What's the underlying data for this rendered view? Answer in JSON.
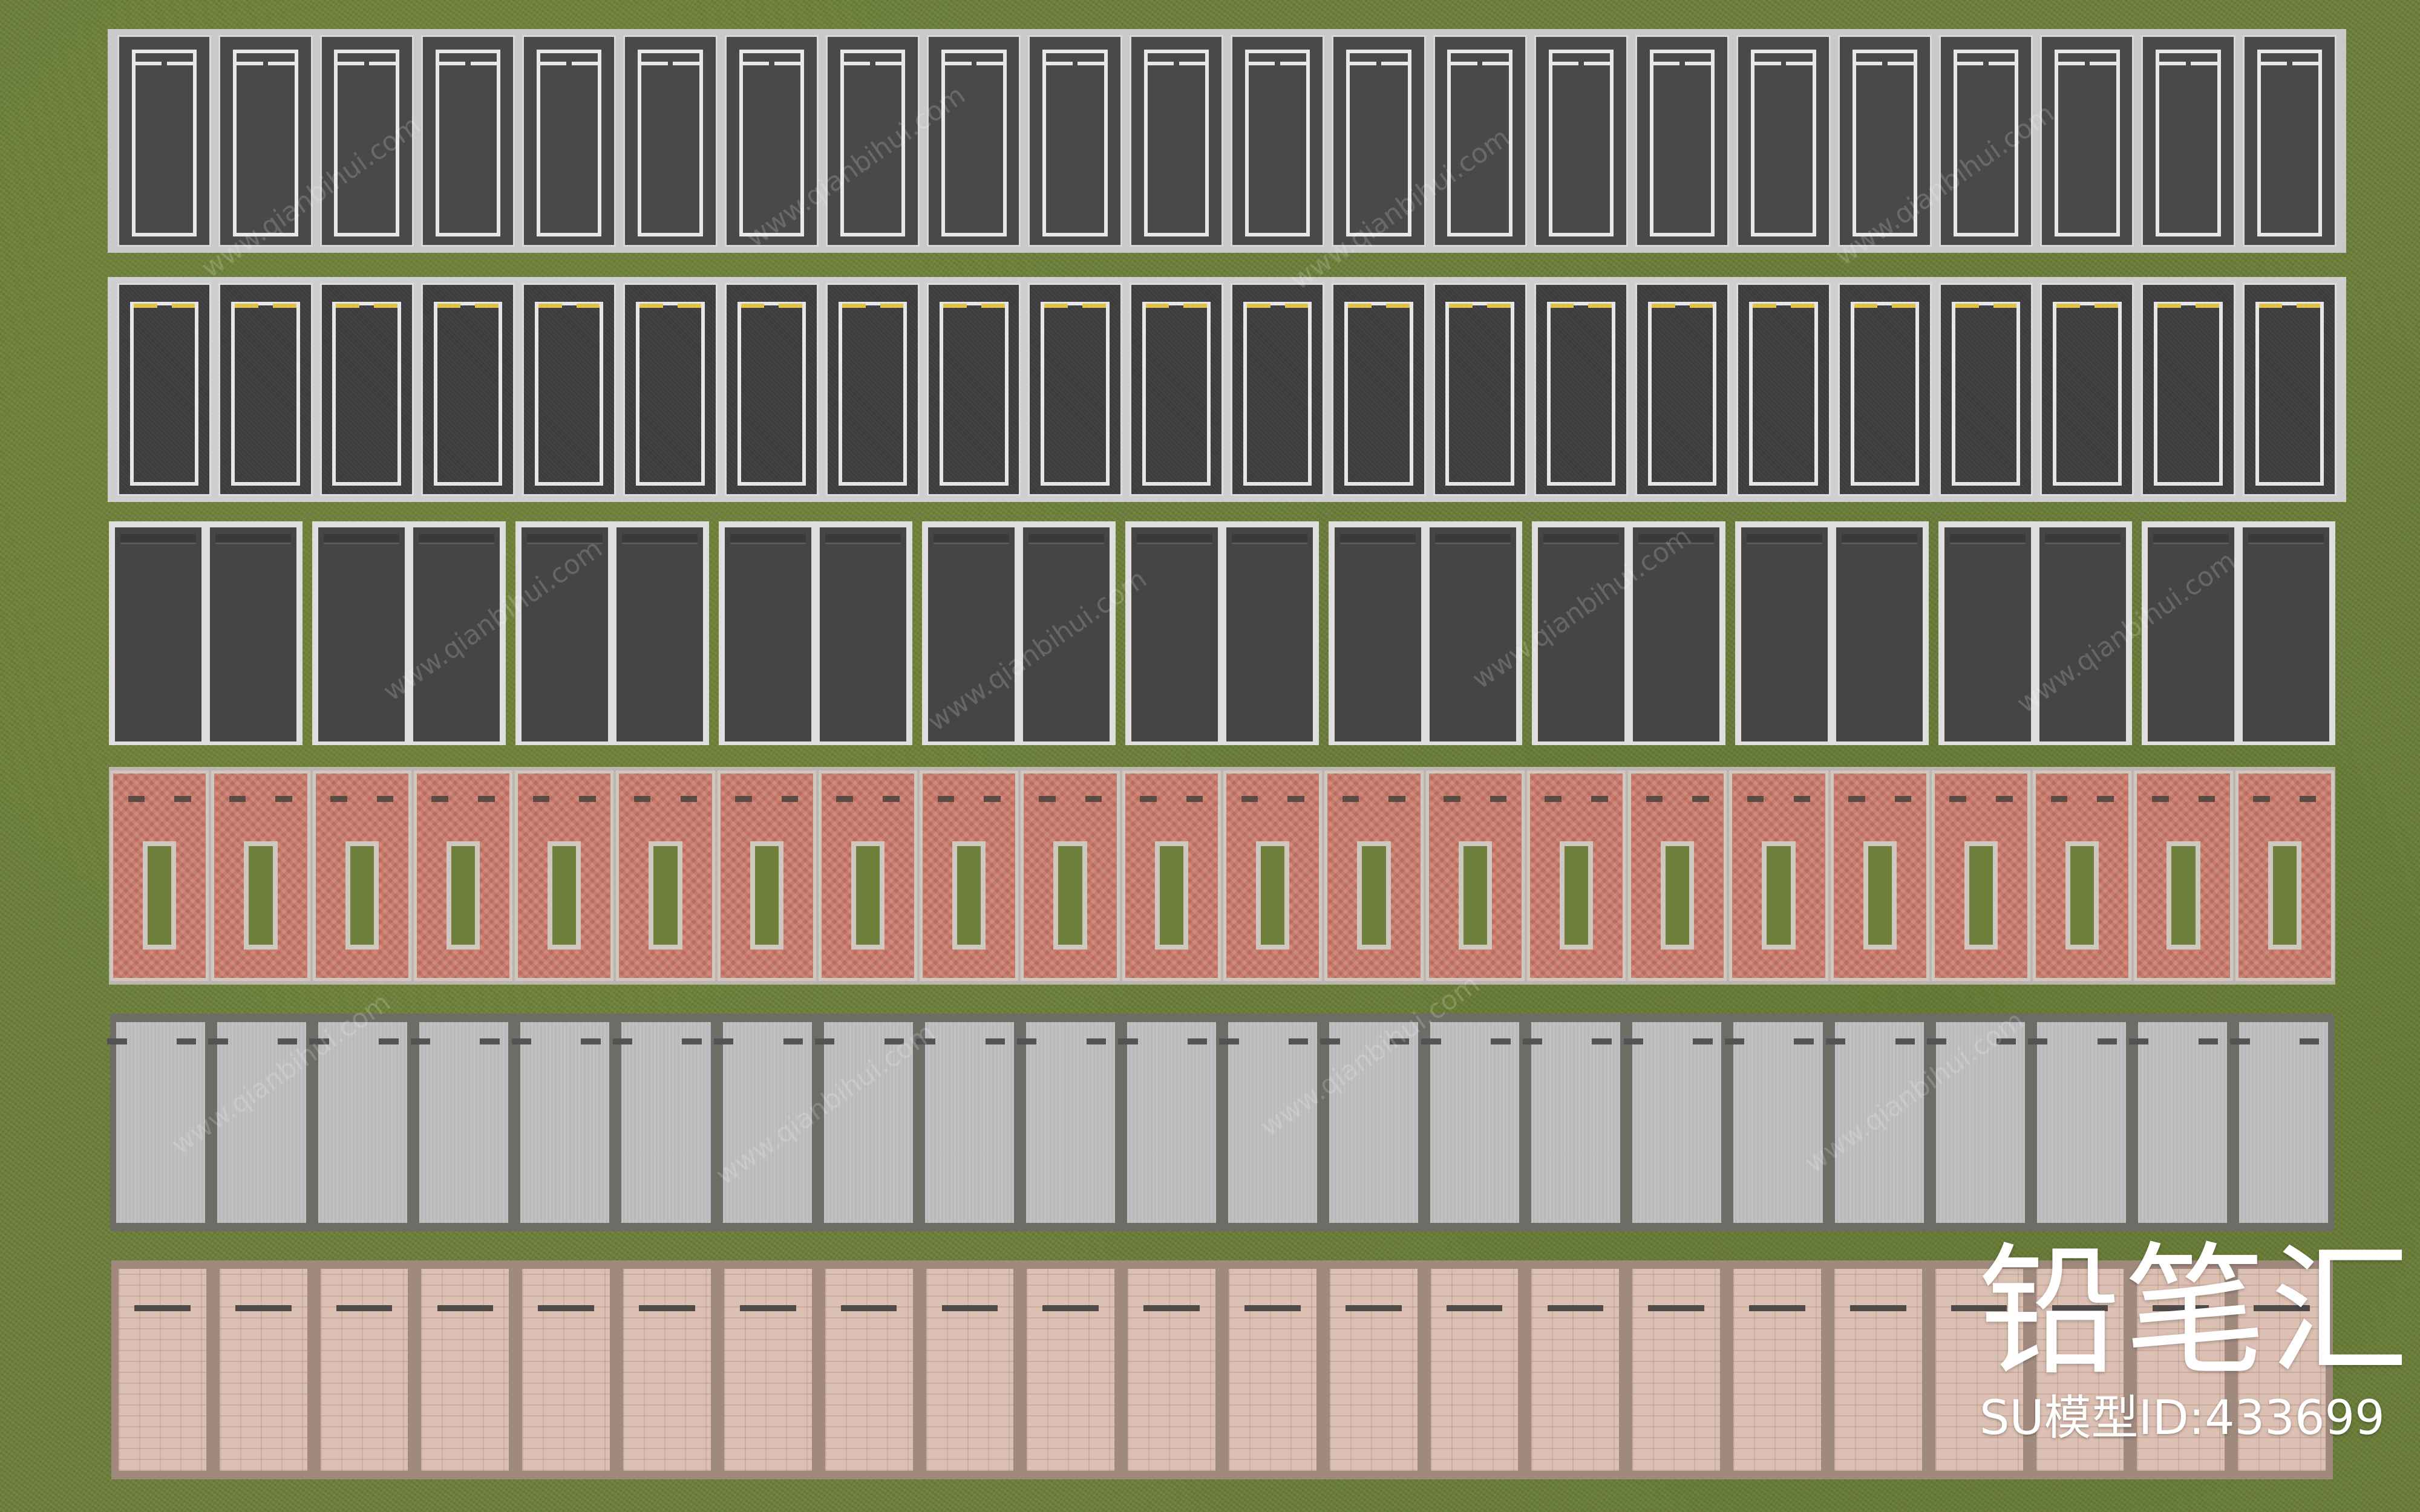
{
  "scene": {
    "description_rows": [
      {
        "id": "row-1",
        "stalls": 22,
        "style": "asphalt-white-lines"
      },
      {
        "id": "row-2",
        "stalls": 22,
        "style": "asphalt-yellow-marks"
      },
      {
        "id": "row-3",
        "pairs": 11,
        "style": "paired-asphalt-open-bottom"
      },
      {
        "id": "row-4",
        "stalls": 22,
        "style": "red-herringbone-grass-center"
      },
      {
        "id": "row-5",
        "stalls": 22,
        "style": "gray-paving"
      },
      {
        "id": "row-6",
        "stalls": 22,
        "style": "pink-brick-paving"
      }
    ],
    "colors": {
      "grass": "#6b7e39",
      "asphalt": "#4a4848",
      "line_white": "#e8e8e8",
      "line_yellow": "#e0c24a",
      "brick_red": "#c97a6b",
      "paving_gray": "#bdbdc0",
      "brick_pink": "#dcc0b3"
    }
  },
  "watermark": {
    "logo_text": "铅笔汇",
    "model_id": "SU模型ID:433699",
    "site_text": "www.qianbihui.com"
  }
}
